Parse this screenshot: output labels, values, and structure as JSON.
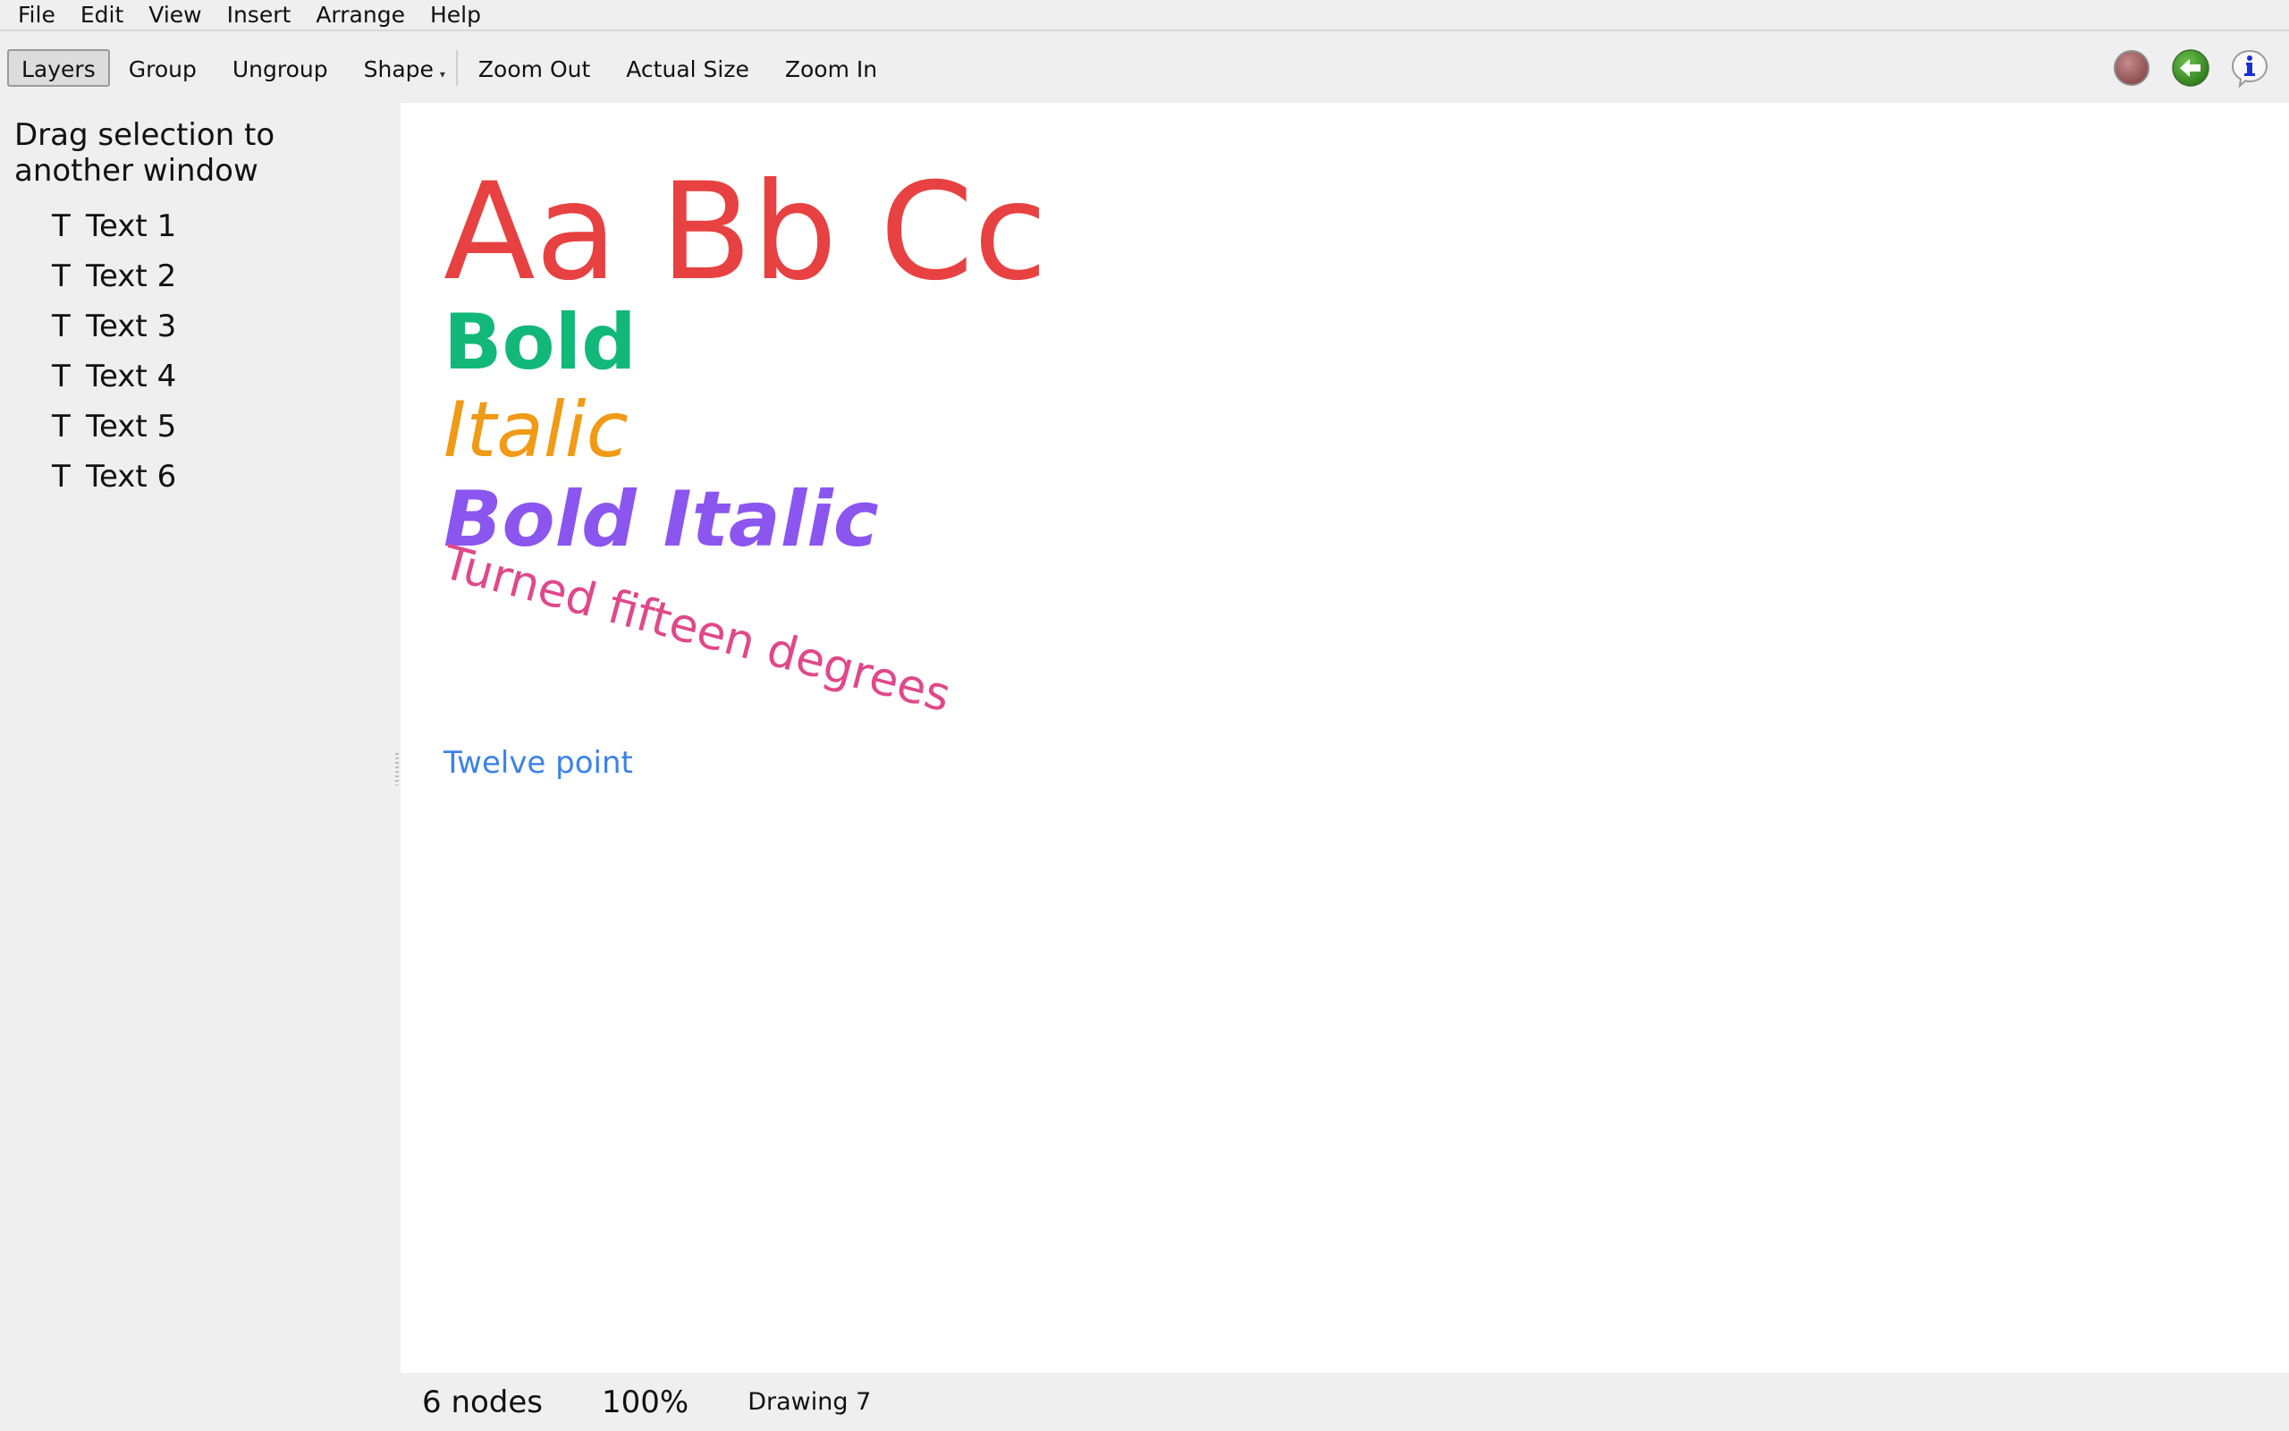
{
  "menu": [
    "File",
    "Edit",
    "View",
    "Insert",
    "Arrange",
    "Help"
  ],
  "toolbar": {
    "layers": "Layers",
    "group": "Group",
    "ungroup": "Ungroup",
    "shape": "Shape",
    "zoom_out": "Zoom Out",
    "actual_size": "Actual Size",
    "zoom_in": "Zoom In",
    "right_icons": [
      "record-icon",
      "back-arrow-icon",
      "info-icon"
    ]
  },
  "sidebar": {
    "hint": "Drag selection to another window",
    "layer_icon": "T",
    "layers": [
      "Text 1",
      "Text 2",
      "Text 3",
      "Text 4",
      "Text 5",
      "Text 6"
    ]
  },
  "canvas": {
    "texts": [
      {
        "text": "Aa Bb Cc",
        "color": "#e84141"
      },
      {
        "text": "Bold",
        "color": "#12b77a"
      },
      {
        "text": "Italic",
        "color": "#f09a16"
      },
      {
        "text": "Bold Italic",
        "color": "#8b55f0"
      },
      {
        "text": "Turned fifteen degrees",
        "color": "#e0488a",
        "rotation_deg": 15
      },
      {
        "text": "Twelve point",
        "color": "#3c82e8"
      }
    ]
  },
  "status": {
    "nodes": "6 nodes",
    "zoom": "100%",
    "document": "Drawing 7"
  }
}
